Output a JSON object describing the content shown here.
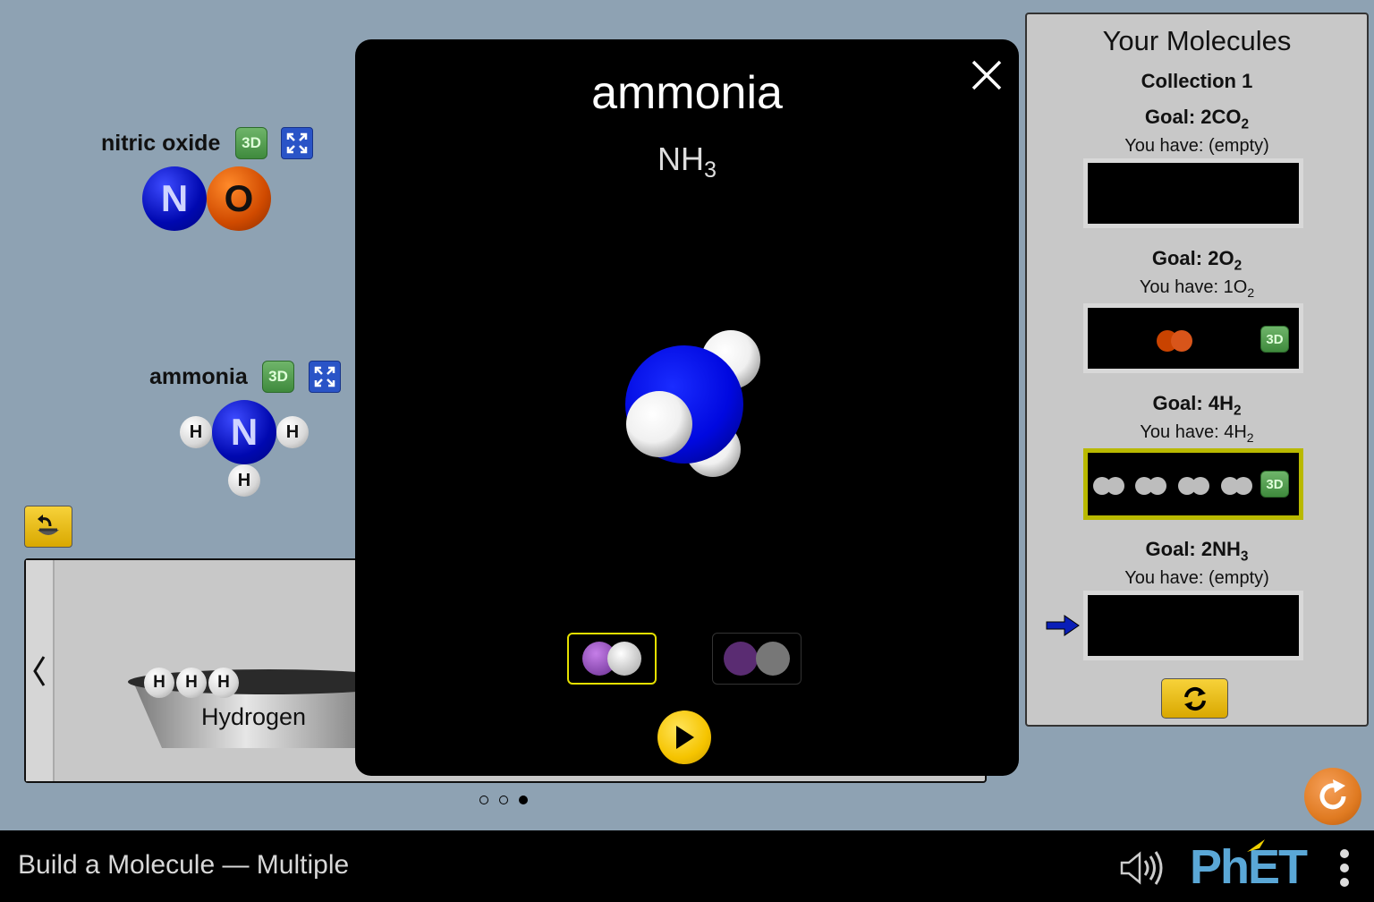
{
  "app": {
    "title": "Build a Molecule — Multiple"
  },
  "play_area": {
    "molecules": [
      {
        "name": "nitric oxide",
        "atoms": [
          "N",
          "O"
        ],
        "btn_3d": "3D"
      },
      {
        "name": "ammonia",
        "atoms": [
          "H",
          "N",
          "H",
          "H"
        ],
        "btn_3d": "3D"
      }
    ]
  },
  "kit": {
    "label": "Hydrogen",
    "atoms": [
      "H",
      "H",
      "H"
    ],
    "page_count": 3,
    "current_page": 3
  },
  "dialog": {
    "title": "ammonia",
    "formula_base": "NH",
    "formula_sub": "3",
    "close_icon": "close-icon",
    "view_modes": [
      "space-filling",
      "ball-and-stick"
    ],
    "selected_view": "space-filling"
  },
  "collection": {
    "header": "Your Molecules",
    "name": "Collection 1",
    "goals": [
      {
        "goal_label": "Goal: ",
        "count": "2",
        "formula": "CO",
        "sub": "2",
        "have_label": "You have: ",
        "have_text": "(empty)",
        "have_sub": "",
        "filled": false
      },
      {
        "goal_label": "Goal: ",
        "count": "2",
        "formula": "O",
        "sub": "2",
        "have_label": "You have: ",
        "have_text": "1O",
        "have_sub": "2",
        "filled": true,
        "btn_3d": "3D"
      },
      {
        "goal_label": "Goal: ",
        "count": "4",
        "formula": "H",
        "sub": "2",
        "have_label": "You have: ",
        "have_text": "4H",
        "have_sub": "2",
        "filled": true,
        "btn_3d": "3D",
        "complete": true
      },
      {
        "goal_label": "Goal: ",
        "count": "2",
        "formula": "NH",
        "sub": "3",
        "have_label": "You have: ",
        "have_text": "(empty)",
        "have_sub": "",
        "filled": false,
        "active": true
      }
    ]
  },
  "footer": {
    "brand": "PhET"
  },
  "colors": {
    "background": "#8ea2b3",
    "nitrogen": "#0008b0",
    "oxygen": "#d04a00",
    "hydrogen": "#ffffff",
    "highlight": "#b9b900",
    "goal_arrow": "#0a1eb8",
    "button_yellow": "#f5c400",
    "reset_orange": "#e07b22"
  }
}
